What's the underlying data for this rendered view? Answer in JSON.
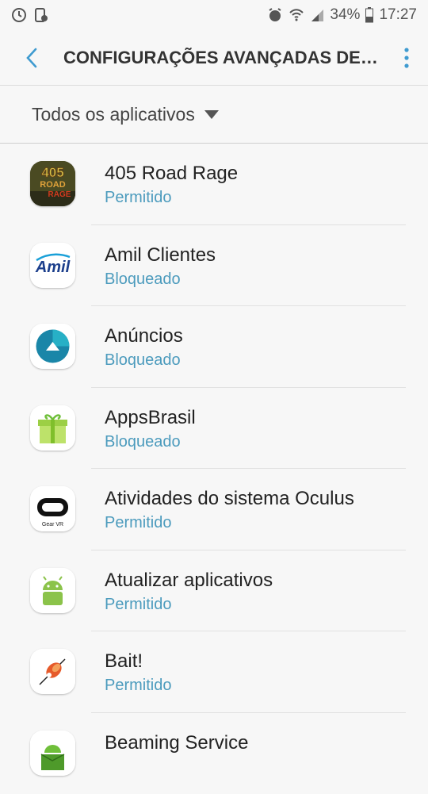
{
  "status_bar": {
    "battery": "34%",
    "time": "17:27"
  },
  "app_bar": {
    "title": "CONFIGURAÇÕES AVANÇADAS DE N..."
  },
  "filter": {
    "label": "Todos os aplicativos"
  },
  "apps": [
    {
      "name": "405 Road Rage",
      "status": "Permitido",
      "icon_text": "405\nROAD\nRAGE"
    },
    {
      "name": "Amil Clientes",
      "status": "Bloqueado",
      "icon_text": "Amil"
    },
    {
      "name": "Anúncios",
      "status": "Bloqueado"
    },
    {
      "name": "AppsBrasil",
      "status": "Bloqueado"
    },
    {
      "name": "Atividades do sistema Oculus",
      "status": "Permitido",
      "icon_text": "Gear VR"
    },
    {
      "name": "Atualizar aplicativos",
      "status": "Permitido"
    },
    {
      "name": "Bait!",
      "status": "Permitido"
    },
    {
      "name": "Beaming Service",
      "status": ""
    }
  ]
}
